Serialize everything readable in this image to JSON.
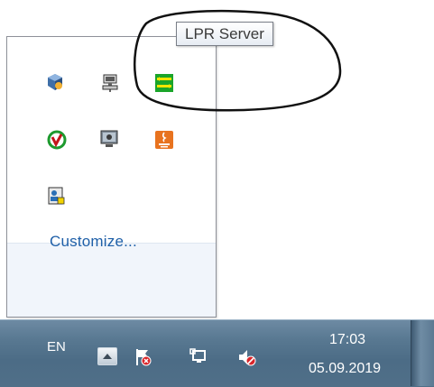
{
  "tooltip": {
    "text": "LPR Server"
  },
  "overflow_panel": {
    "icons": [
      {
        "name": "virtualbox-icon"
      },
      {
        "name": "network-computer-icon"
      },
      {
        "name": "lpr-server-icon"
      },
      {
        "name": "antivirus-check-icon"
      },
      {
        "name": "monitor-display-icon"
      },
      {
        "name": "java-icon"
      },
      {
        "name": "user-card-icon"
      }
    ],
    "customize_label": "Customize..."
  },
  "taskbar": {
    "language": "EN",
    "time": "17:03",
    "date": "05.09.2019",
    "icons": [
      "show-hidden-icons-button",
      "action-center-flag-icon",
      "network-icon",
      "volume-muted-icon"
    ]
  },
  "colors": {
    "taskbar": "#587891",
    "link": "#1e5fa8",
    "panel_footer": "#f1f5fb"
  }
}
